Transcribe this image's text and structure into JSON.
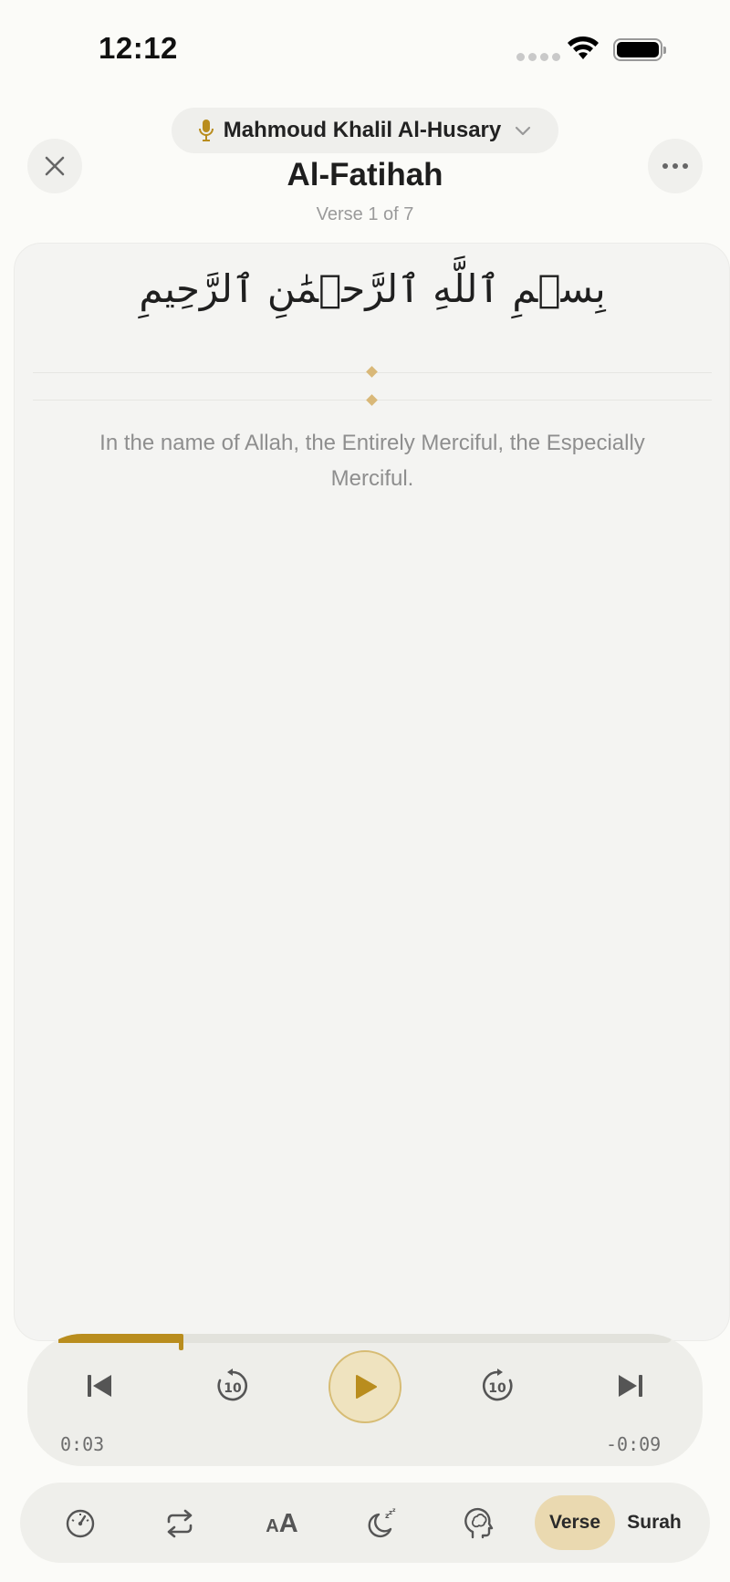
{
  "status_bar": {
    "time": "12:12"
  },
  "header": {
    "reciter": "Mahmoud Khalil Al-Husary",
    "surah_title": "Al-Fatihah",
    "verse_counter": "Verse 1 of 7"
  },
  "verse": {
    "arabic": "بِسۡمِ ٱللَّهِ ٱلرَّحۡمَٰنِ ٱلرَّحِيمِ",
    "translation": "In the name of Allah, the Entirely Merciful, the Especially Merciful."
  },
  "player": {
    "progress": 0.2,
    "elapsed": "0:03",
    "remaining": "-0:09",
    "skip_back_seconds": "10",
    "skip_forward_seconds": "10"
  },
  "toolbar": {
    "text_size_label_small": "A",
    "text_size_label_large": "A",
    "modes": [
      "Verse",
      "Surah"
    ],
    "active_mode": "Verse"
  },
  "colors": {
    "accent": "#b98d1e",
    "accent_soft": "#ead9b0",
    "background": "#fbfbf8"
  }
}
